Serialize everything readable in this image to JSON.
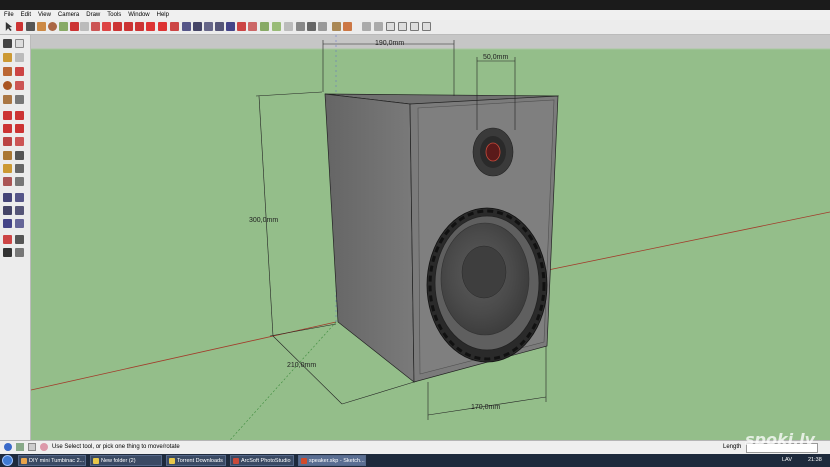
{
  "menu": [
    "File",
    "Edit",
    "View",
    "Camera",
    "Draw",
    "Tools",
    "Window",
    "Help"
  ],
  "dimensions": {
    "width_top": "190,0mm",
    "tweeter": "50,0mm",
    "height": "300,0mm",
    "depth": "210,0mm",
    "width_front": "170,0mm"
  },
  "status": {
    "hint": "Use Select tool, or pick one thing to move/rotate",
    "length_label": "Length"
  },
  "taskbar": {
    "items": [
      {
        "label": "DIY mini Tumbinac 2..."
      },
      {
        "label": "New folder (2)"
      },
      {
        "label": "Torrent Downloads"
      },
      {
        "label": "ArcSoft PhotoStudio"
      },
      {
        "label": "speaker.skp - Sketch..."
      }
    ],
    "lang": "LAV",
    "clock": "21:38"
  },
  "watermark": "spoki.lv",
  "colors": {
    "ground": "#94be8a",
    "sky": "#c6c6c6",
    "box": "#6f6f6f"
  }
}
